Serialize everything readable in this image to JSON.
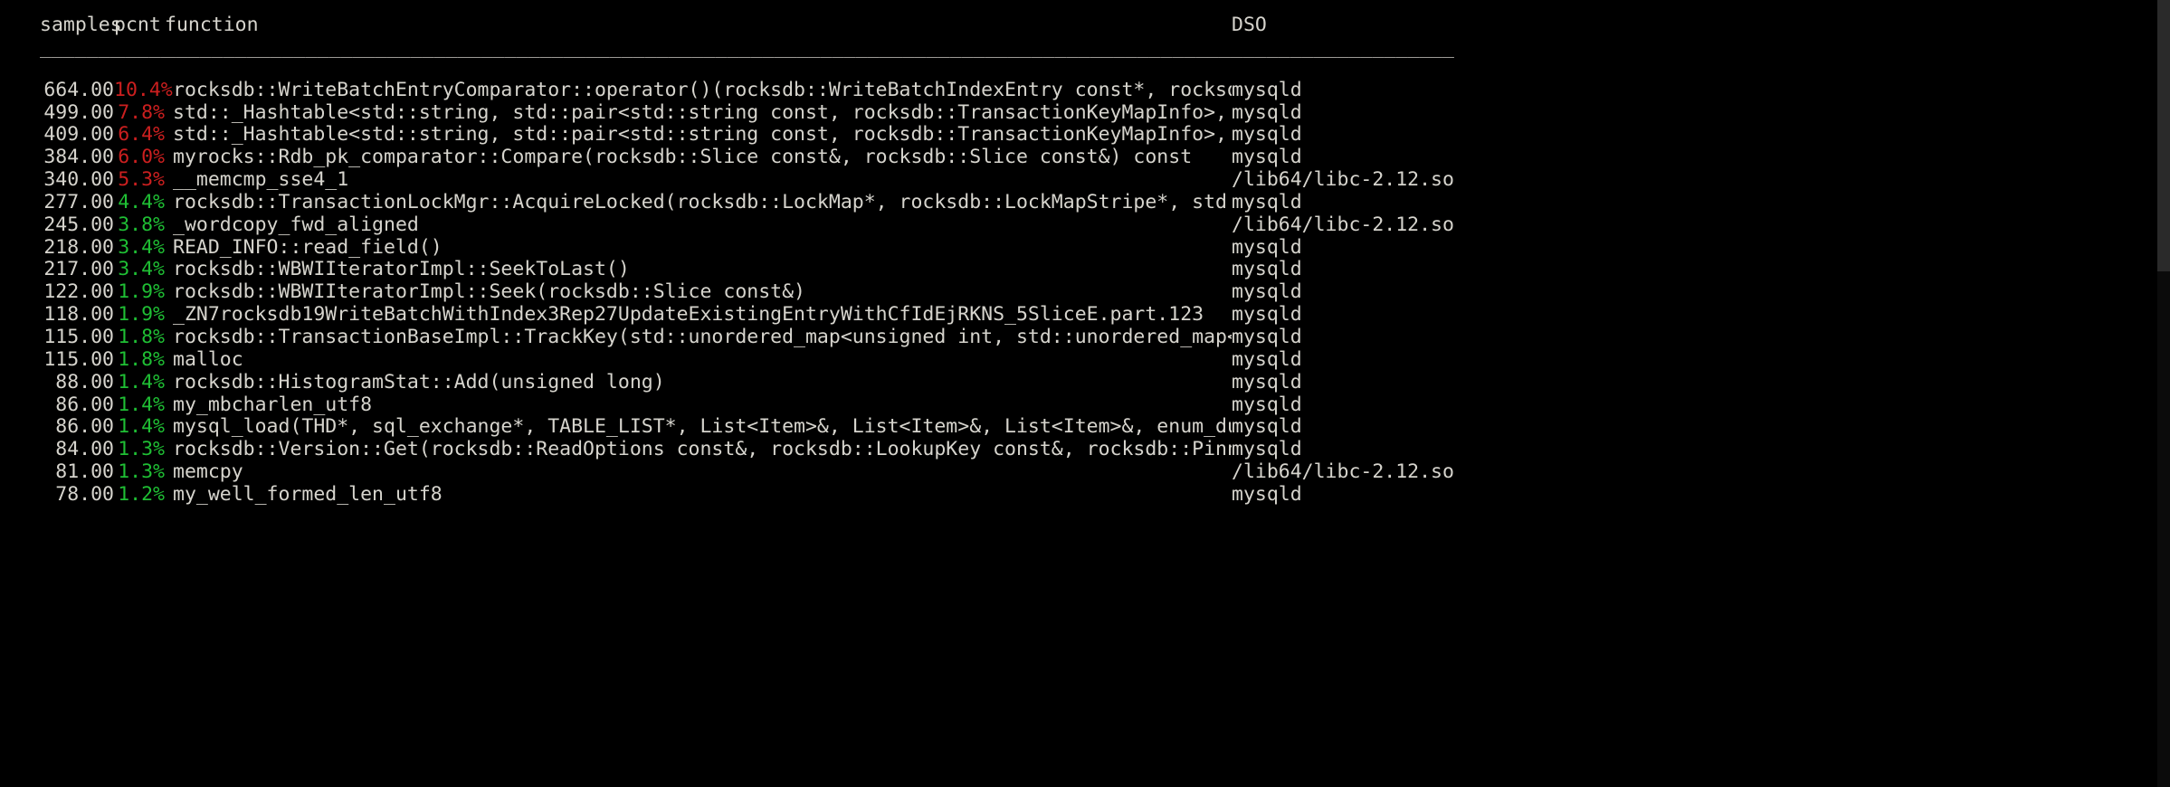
{
  "terminal": {
    "background": "#000000",
    "foreground": "#d6d4cd",
    "hot_color": "#cc1f1f",
    "warm_color": "#1fbf34"
  },
  "header": {
    "samples": "samples",
    "pcnt": "pcnt",
    "function": "function",
    "dso": "DSO"
  },
  "separators": {
    "samples": "________",
    "pcnt": "_____",
    "function": "_____________________________________________________________________________________________________________________________________________",
    "dso": "___________________"
  },
  "rows": [
    {
      "samples": "664.00",
      "pcnt": "10.4%",
      "function": "rocksdb::WriteBatchEntryComparator::operator()(rocksdb::WriteBatchIndexEntry const*, rocksdb::WriteBatchIndexE",
      "dso": "mysqld"
    },
    {
      "samples": "499.00",
      "pcnt": "7.8%",
      "function": "std::_Hashtable<std::string, std::pair<std::string const, rocksdb::TransactionKeyMapInfo>, std::allocator<std:",
      "dso": "mysqld"
    },
    {
      "samples": "409.00",
      "pcnt": "6.4%",
      "function": "std::_Hashtable<std::string, std::pair<std::string const, rocksdb::TransactionKeyMapInfo>, std::allocator<std:",
      "dso": "mysqld"
    },
    {
      "samples": "384.00",
      "pcnt": "6.0%",
      "function": "myrocks::Rdb_pk_comparator::Compare(rocksdb::Slice const&, rocksdb::Slice const&) const",
      "dso": "mysqld"
    },
    {
      "samples": "340.00",
      "pcnt": "5.3%",
      "function": "__memcmp_sse4_1",
      "dso": "/lib64/libc-2.12.so"
    },
    {
      "samples": "277.00",
      "pcnt": "4.4%",
      "function": "rocksdb::TransactionLockMgr::AcquireLocked(rocksdb::LockMap*, rocksdb::LockMapStripe*, std::string const&, roc",
      "dso": "mysqld"
    },
    {
      "samples": "245.00",
      "pcnt": "3.8%",
      "function": "_wordcopy_fwd_aligned",
      "dso": "/lib64/libc-2.12.so"
    },
    {
      "samples": "218.00",
      "pcnt": "3.4%",
      "function": "READ_INFO::read_field()",
      "dso": "mysqld"
    },
    {
      "samples": "217.00",
      "pcnt": "3.4%",
      "function": "rocksdb::WBWIIteratorImpl::SeekToLast()",
      "dso": "mysqld"
    },
    {
      "samples": "122.00",
      "pcnt": "1.9%",
      "function": "rocksdb::WBWIIteratorImpl::Seek(rocksdb::Slice const&)",
      "dso": "mysqld"
    },
    {
      "samples": "118.00",
      "pcnt": "1.9%",
      "function": "_ZN7rocksdb19WriteBatchWithIndex3Rep27UpdateExistingEntryWithCfIdEjRKNS_5SliceE.part.123",
      "dso": "mysqld"
    },
    {
      "samples": "115.00",
      "pcnt": "1.8%",
      "function": "rocksdb::TransactionBaseImpl::TrackKey(std::unordered_map<unsigned int, std::unordered_map<std::string, rocksd",
      "dso": "mysqld"
    },
    {
      "samples": "115.00",
      "pcnt": "1.8%",
      "function": "malloc",
      "dso": "mysqld"
    },
    {
      "samples": "88.00",
      "pcnt": "1.4%",
      "function": "rocksdb::HistogramStat::Add(unsigned long)",
      "dso": "mysqld"
    },
    {
      "samples": "86.00",
      "pcnt": "1.4%",
      "function": "my_mbcharlen_utf8",
      "dso": "mysqld"
    },
    {
      "samples": "86.00",
      "pcnt": "1.4%",
      "function": "mysql_load(THD*, sql_exchange*, TABLE_LIST*, List<Item>&, List<Item>&, List<Item>&, enum_duplicates, bool, boo",
      "dso": "mysqld"
    },
    {
      "samples": "84.00",
      "pcnt": "1.3%",
      "function": "rocksdb::Version::Get(rocksdb::ReadOptions const&, rocksdb::LookupKey const&, rocksdb::PinnableSlice*, rocksdb",
      "dso": "mysqld"
    },
    {
      "samples": "81.00",
      "pcnt": "1.3%",
      "function": "memcpy",
      "dso": "/lib64/libc-2.12.so"
    },
    {
      "samples": "78.00",
      "pcnt": "1.2%",
      "function": "my_well_formed_len_utf8",
      "dso": "mysqld"
    }
  ],
  "hot_threshold_count": 5
}
